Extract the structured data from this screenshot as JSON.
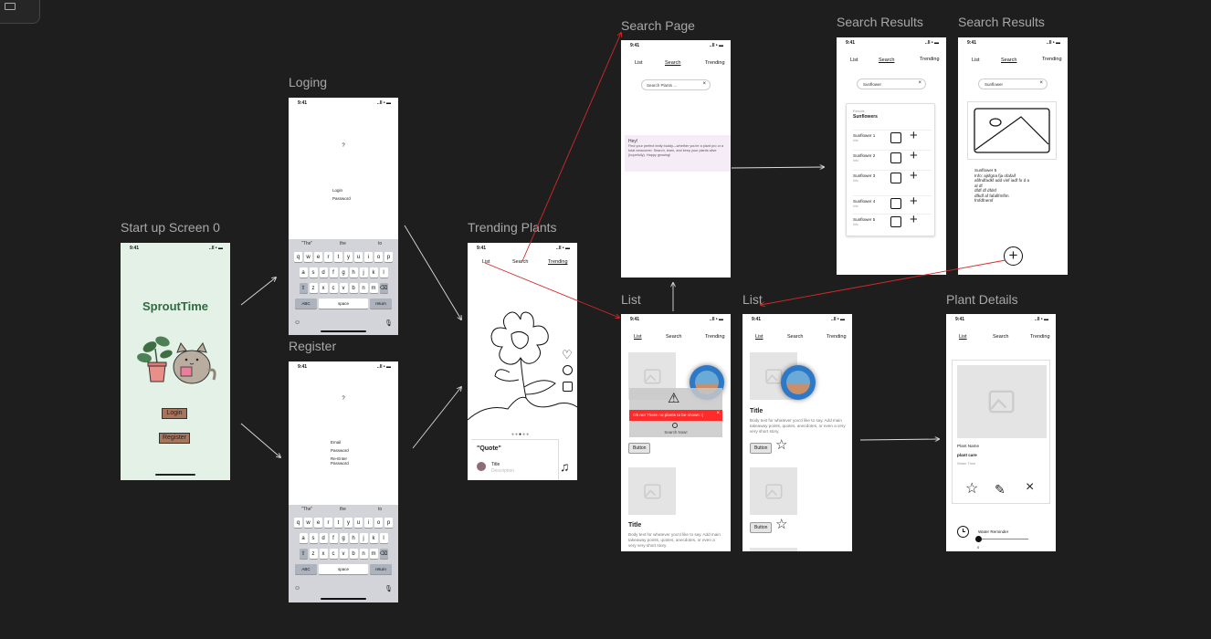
{
  "labels": {
    "startup": "Start up Screen 0",
    "loging": "Loging",
    "register": "Register",
    "trending": "Trending Plants",
    "search_page": "Search Page",
    "search_results_1": "Search Results",
    "search_results_2": "Search Results",
    "list_1": "List",
    "list_2": "List",
    "plant_details": "Plant Details"
  },
  "status": {
    "time": "9:41",
    "icons": "..ll • ▬"
  },
  "tabs": {
    "list": "List",
    "search": "Search",
    "trending": "Trending"
  },
  "startup": {
    "app_name": "SproutTime",
    "login": "Login",
    "register": "Register"
  },
  "login": {
    "question": "?",
    "login_field": "Login",
    "password_field": "Password"
  },
  "register": {
    "question": "?",
    "email": "Email",
    "password": "Password",
    "re_enter": "Re-Enter Password"
  },
  "keyboard": {
    "suggestions": [
      "\"The\"",
      "the",
      "to"
    ],
    "row1": [
      "q",
      "w",
      "e",
      "r",
      "t",
      "y",
      "u",
      "i",
      "o",
      "p"
    ],
    "row2": [
      "a",
      "s",
      "d",
      "f",
      "g",
      "h",
      "j",
      "k",
      "l"
    ],
    "row3": [
      "z",
      "x",
      "c",
      "v",
      "b",
      "n",
      "m"
    ],
    "abc": "ABC",
    "space": "space",
    "return": "return"
  },
  "trending": {
    "quote": "\"Quote\"",
    "title": "Title",
    "description": "Description"
  },
  "search_page": {
    "placeholder": "Search Plants ...",
    "intro_heading": "Hey!",
    "intro_body": "Find your perfect leafy buddy—whether you're a plant pro or a total newcomer. Search, learn, and keep your plants alive (hopefully). Happy growing!"
  },
  "search_results": {
    "query": "Sunflower",
    "results_label": "Results",
    "results_for": "Sunflowers",
    "items": [
      {
        "name": "Sunflower 1",
        "info": "Info"
      },
      {
        "name": "Sunflower 2",
        "info": "Info"
      },
      {
        "name": "Sunflower 3",
        "info": "Info"
      },
      {
        "name": "Sunflower 4",
        "info": "Info"
      },
      {
        "name": "Sunflower 5",
        "info": "Info"
      }
    ]
  },
  "search_detail": {
    "query": "Sunflower",
    "lines": [
      "Sunflower 5",
      "Info: ajsfgna fja ofafaif",
      "afifndfadkf add vinf iadf fo d a",
      "al df",
      "dfdf df dfdsf",
      "dfkdf af fafafifmflm",
      "fmfdfnemf"
    ]
  },
  "list1": {
    "error": "Oh no! There no plants to be shown :(",
    "search_now": "Search Now!",
    "button": "Button",
    "title": "Title",
    "body": "Body text for whatever you'd like to say. Add main takeaway points, quotes, anecdotes, or even a very very short story."
  },
  "list2": {
    "title": "Title",
    "body": "Body text for whatever you'd like to say. Add main takeaway points, quotes, anecdotes, or even a very very short story.",
    "button": "Button",
    "button2": "Button"
  },
  "details": {
    "plant_name": "Plant Name",
    "plant_care": "plant care",
    "water_time": "Water Time",
    "water_reminder": "Water Reminder",
    "slider_value": "0"
  },
  "colors": {
    "canvas": "#1e1e1e",
    "startup_bg": "#e3f1e6",
    "brand_green": "#2f6b3e",
    "startup_button": "#a8745b",
    "error_red": "#ff2b2b",
    "arrow_red": "#d42a2a",
    "search_intro_bg": "#f6ecf8"
  }
}
